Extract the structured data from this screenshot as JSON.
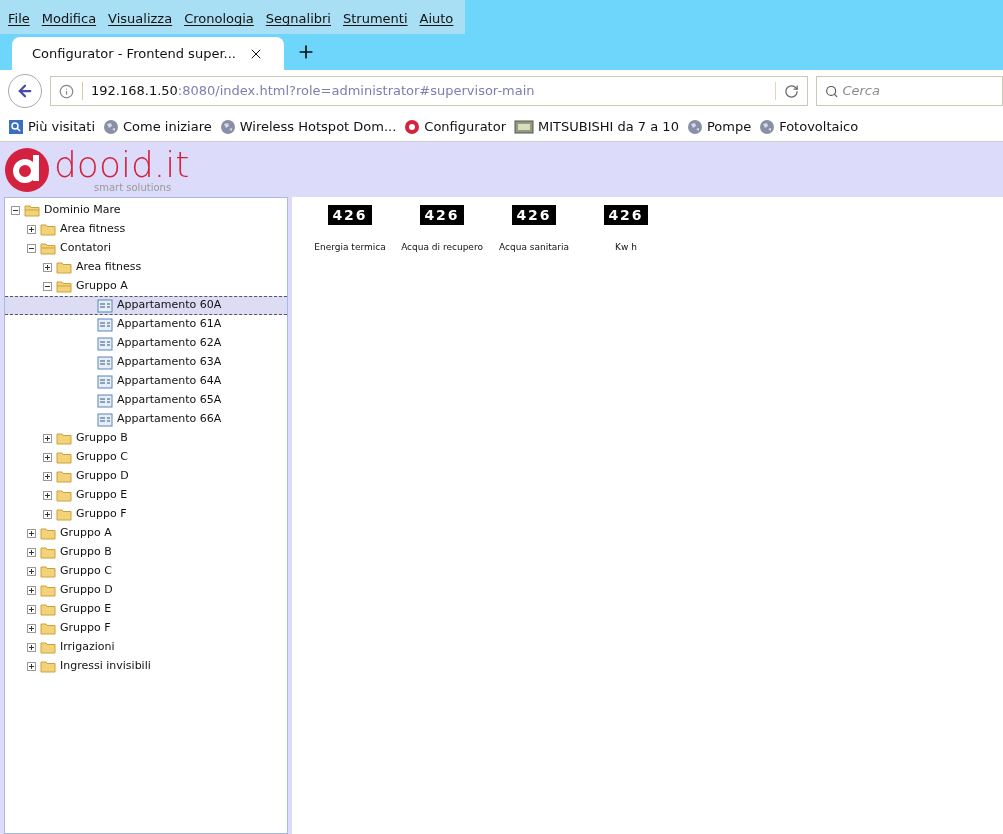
{
  "menu": [
    "File",
    "Modifica",
    "Visualizza",
    "Cronologia",
    "Segnalibri",
    "Strumenti",
    "Aiuto"
  ],
  "tabs": [
    {
      "title": "Configurator - Frontend super...",
      "selected": true
    }
  ],
  "address": {
    "host": "192.168.1.50",
    "rest": ":8080/index.html?role=administrator#supervisor-main"
  },
  "search": {
    "placeholder": "Cerca"
  },
  "bookmarks": [
    {
      "label": "Più visitati",
      "kind": "star"
    },
    {
      "label": "Come iniziare",
      "kind": "globe"
    },
    {
      "label": "Wireless Hotspot Dom...",
      "kind": "globe"
    },
    {
      "label": "Configurator",
      "kind": "brand"
    },
    {
      "label": "MITSUBISHI da 7 a 10",
      "kind": "page"
    },
    {
      "label": "Pompe",
      "kind": "globe"
    },
    {
      "label": "Fotovoltaico",
      "kind": "globe"
    }
  ],
  "logo": {
    "name": "dooid.it",
    "tagline": "smart solutions"
  },
  "tree": [
    {
      "label": "Dominio Mare",
      "kind": "folder",
      "expanded": true,
      "selected": false,
      "children": [
        {
          "label": "Area fitness",
          "kind": "folder",
          "expanded": false,
          "selected": false
        },
        {
          "label": "Contatori",
          "kind": "folder",
          "expanded": true,
          "selected": false,
          "children": [
            {
              "label": "Area fitness",
              "kind": "folder",
              "expanded": false,
              "selected": false
            },
            {
              "label": "Gruppo A",
              "kind": "folder",
              "expanded": true,
              "selected": false,
              "children": [
                {
                  "label": "Appartamento 60A",
                  "kind": "item",
                  "selected": true
                },
                {
                  "label": "Appartamento 61A",
                  "kind": "item",
                  "selected": false
                },
                {
                  "label": "Appartamento 62A",
                  "kind": "item",
                  "selected": false
                },
                {
                  "label": "Appartamento 63A",
                  "kind": "item",
                  "selected": false
                },
                {
                  "label": "Appartamento 64A",
                  "kind": "item",
                  "selected": false
                },
                {
                  "label": "Appartamento 65A",
                  "kind": "item",
                  "selected": false
                },
                {
                  "label": "Appartamento 66A",
                  "kind": "item",
                  "selected": false
                }
              ]
            },
            {
              "label": "Gruppo B",
              "kind": "folder",
              "expanded": false,
              "selected": false
            },
            {
              "label": "Gruppo C",
              "kind": "folder",
              "expanded": false,
              "selected": false
            },
            {
              "label": "Gruppo D",
              "kind": "folder",
              "expanded": false,
              "selected": false
            },
            {
              "label": "Gruppo E",
              "kind": "folder",
              "expanded": false,
              "selected": false
            },
            {
              "label": "Gruppo F",
              "kind": "folder",
              "expanded": false,
              "selected": false
            }
          ]
        },
        {
          "label": "Gruppo A",
          "kind": "folder",
          "expanded": false,
          "selected": false
        },
        {
          "label": "Gruppo B",
          "kind": "folder",
          "expanded": false,
          "selected": false
        },
        {
          "label": "Gruppo C",
          "kind": "folder",
          "expanded": false,
          "selected": false
        },
        {
          "label": "Gruppo D",
          "kind": "folder",
          "expanded": false,
          "selected": false
        },
        {
          "label": "Gruppo E",
          "kind": "folder",
          "expanded": false,
          "selected": false
        },
        {
          "label": "Gruppo F",
          "kind": "folder",
          "expanded": false,
          "selected": false
        },
        {
          "label": "Irrigazioni",
          "kind": "folder",
          "expanded": false,
          "selected": false
        },
        {
          "label": "Ingressi invisibili",
          "kind": "folder",
          "expanded": false,
          "selected": false
        }
      ]
    }
  ],
  "counters": [
    {
      "reading": "426",
      "label": "Energia termica"
    },
    {
      "reading": "426",
      "label": "Acqua di recupero"
    },
    {
      "reading": "426",
      "label": "Acqua sanitaria"
    },
    {
      "reading": "426",
      "label": "Kw h"
    }
  ]
}
